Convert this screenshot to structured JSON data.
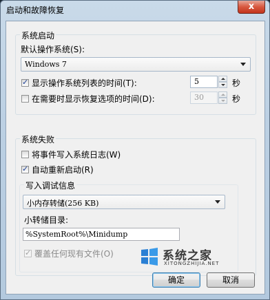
{
  "window": {
    "title": "启动和故障恢复",
    "close_glyph": "x"
  },
  "system_startup": {
    "legend": "系统启动",
    "default_os_label": "默认操作系统(S):",
    "default_os_value": "Windows 7",
    "show_os_list": {
      "label": "显示操作系统列表的时间(T):",
      "checked": true,
      "value": "5",
      "unit": "秒"
    },
    "show_recovery": {
      "label": "在需要时显示恢复选项的时间(D):",
      "checked": false,
      "value": "30",
      "unit": "秒"
    }
  },
  "system_failure": {
    "legend": "系统失败",
    "write_event": {
      "label": "将事件写入系统日志(W)",
      "checked": false
    },
    "auto_restart": {
      "label": "自动重新启动(R)",
      "checked": true
    },
    "debug_info": {
      "legend": "写入调试信息",
      "dump_type": "小内存转储(256 KB)",
      "dump_dir_label": "小转储目录:",
      "dump_dir_value": "%SystemRoot%\\Minidump",
      "overwrite": {
        "label": "覆盖任何现有文件(O)",
        "checked": true,
        "disabled": true
      }
    }
  },
  "buttons": {
    "ok": "确定",
    "cancel": "取消"
  },
  "watermark": {
    "text": "系统之家",
    "sub": "XITONGZHIJIA.NET"
  },
  "colors": {
    "accent": "#3c7fb1",
    "title_close": "#c2341c"
  }
}
